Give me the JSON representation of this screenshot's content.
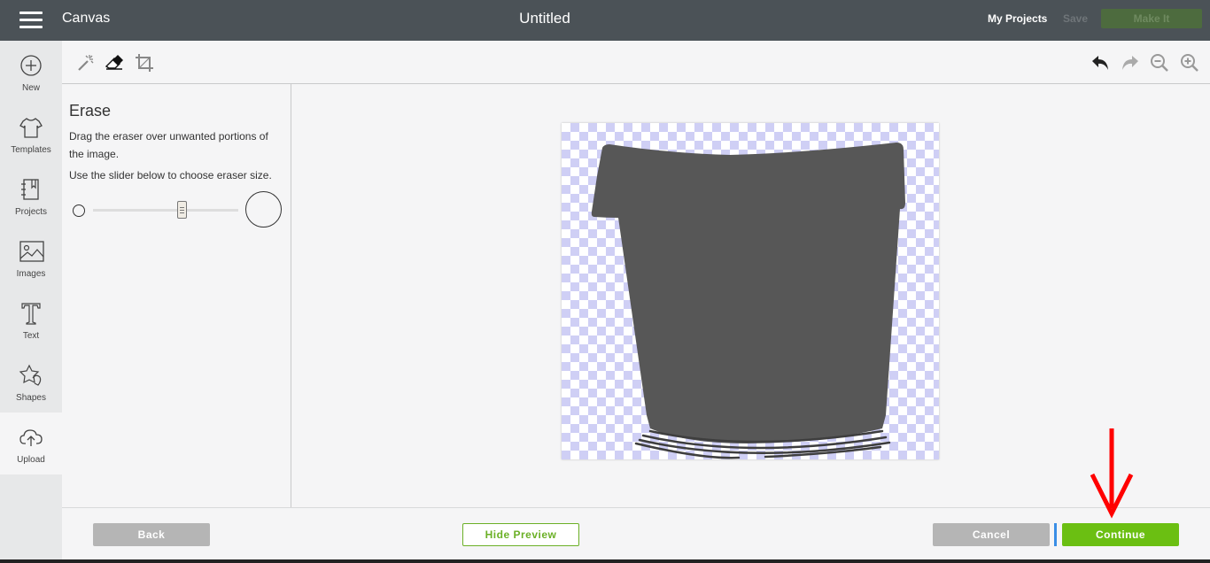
{
  "topbar": {
    "app_name": "Canvas",
    "doc_title": "Untitled",
    "my_projects": "My Projects",
    "save": "Save",
    "make_it": "Make It"
  },
  "leftnav": {
    "items": [
      {
        "label": "New",
        "icon": "plus-circle-icon"
      },
      {
        "label": "Templates",
        "icon": "tshirt-icon"
      },
      {
        "label": "Projects",
        "icon": "notebook-icon"
      },
      {
        "label": "Images",
        "icon": "image-icon"
      },
      {
        "label": "Text",
        "icon": "text-icon"
      },
      {
        "label": "Shapes",
        "icon": "shapes-icon"
      },
      {
        "label": "Upload",
        "icon": "cloud-upload-icon",
        "active": true
      }
    ]
  },
  "toolbar": {
    "left_tools": [
      "magic-wand-icon",
      "eraser-icon",
      "crop-icon"
    ],
    "right_tools": [
      "undo-icon",
      "redo-icon",
      "zoom-out-icon",
      "zoom-in-icon"
    ]
  },
  "panel": {
    "title": "Erase",
    "instruction": "Drag the eraser over unwanted portions of the image.",
    "slider_instruction": "Use the slider below to choose eraser size.",
    "eraser_size_fraction": 0.6
  },
  "footer": {
    "back": "Back",
    "hide_preview": "Hide Preview",
    "cancel": "Cancel",
    "continue": "Continue"
  },
  "colors": {
    "topbar": "#4b5257",
    "continue_green": "#6bbf12",
    "shape_fill": "#575757",
    "checker": "#cfcff5",
    "arrow_red": "#ff0000"
  }
}
